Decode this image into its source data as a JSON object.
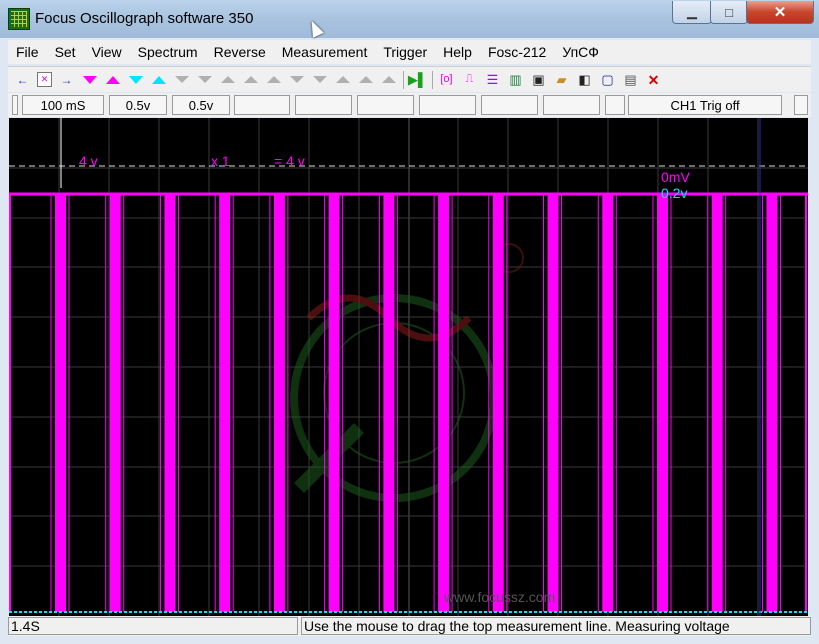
{
  "window": {
    "title": "Focus Oscillograph software 350",
    "minimize_glyph": "▁",
    "maximize_glyph": "□",
    "close_glyph": "✕"
  },
  "menu": [
    "File",
    "Set",
    "View",
    "Spectrum",
    "Reverse",
    "Measurement",
    "Trigger",
    "Help",
    "Fosc-212",
    "УпСФ"
  ],
  "toolbar": {
    "icons": [
      "arrow-left-icon",
      "zoom-fit-icon",
      "arrow-right-icon",
      "ch1-down-icon",
      "ch1-up-icon",
      "ch2-down-icon",
      "ch2-up-icon",
      "ch3-down-icon",
      "ch3-up-icon",
      "ch4-down-icon",
      "ch4-up-icon",
      "ch5-down-icon",
      "ch5-up-icon",
      "ch6-down-icon",
      "ch6-up-icon",
      "ch7-down-icon",
      "ch7-up-icon",
      "run-icon",
      "capture-icon",
      "pulse-icon",
      "table-icon",
      "print-icon",
      "save-icon",
      "open-folder-icon",
      "contrast-icon",
      "frame-icon",
      "export-icon",
      "delete-icon"
    ]
  },
  "settings_bar": {
    "timebase": "100 mS",
    "ch1_volts": "0.5v",
    "ch2_volts": "0.5v",
    "trigger_status": "CH1 Trig off"
  },
  "scope": {
    "ch1_scale": "4 v",
    "multiplier": "x 1",
    "result": "= 4 v",
    "offset_ch1": "0mV",
    "offset_ch2": "0.2v",
    "watermark": "www.focussz.com",
    "colors": {
      "ch1": "#ff00ff",
      "ch2": "#00e5ff",
      "grid": "#3a3a3a",
      "background": "#000000"
    }
  },
  "status_bar": {
    "time_position": "1.4S",
    "hint": "Use the mouse to drag the top measurement line. Measuring voltage"
  }
}
